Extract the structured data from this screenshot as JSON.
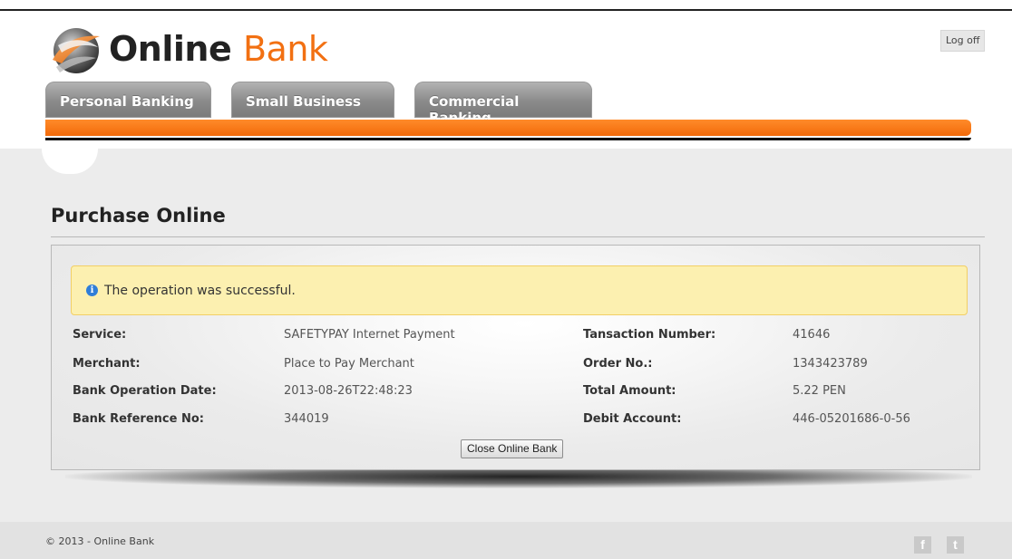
{
  "brand": {
    "name_part1": "Online",
    "name_part2": "Bank",
    "accent_color": "#f27012"
  },
  "header": {
    "logoff_label": "Log off"
  },
  "tabs": [
    {
      "label": "Personal Banking"
    },
    {
      "label": "Small Business"
    },
    {
      "label": "Commercial Banking"
    }
  ],
  "page": {
    "title": "Purchase Online"
  },
  "alert": {
    "icon": "info-icon",
    "message": "The operation was successful."
  },
  "details": {
    "left": [
      {
        "label": "Service:",
        "value": "SAFETYPAY Internet Payment"
      },
      {
        "label": "Merchant:",
        "value": "Place to Pay Merchant"
      },
      {
        "label": "Bank Operation Date:",
        "value": "2013-08-26T22:48:23"
      },
      {
        "label": "Bank Reference No:",
        "value": "344019"
      }
    ],
    "right": [
      {
        "label": "Tansaction Number:",
        "value": "41646"
      },
      {
        "label": "Order No.:",
        "value": "1343423789"
      },
      {
        "label": "Total Amount:",
        "value": "5.22 PEN"
      },
      {
        "label": "Debit Account:",
        "value": "446-05201686-0-56"
      }
    ]
  },
  "actions": {
    "close_label": "Close Online Bank"
  },
  "footer": {
    "copyright": "© 2013 - Online Bank",
    "facebook_glyph": "f",
    "twitter_glyph": "t"
  }
}
